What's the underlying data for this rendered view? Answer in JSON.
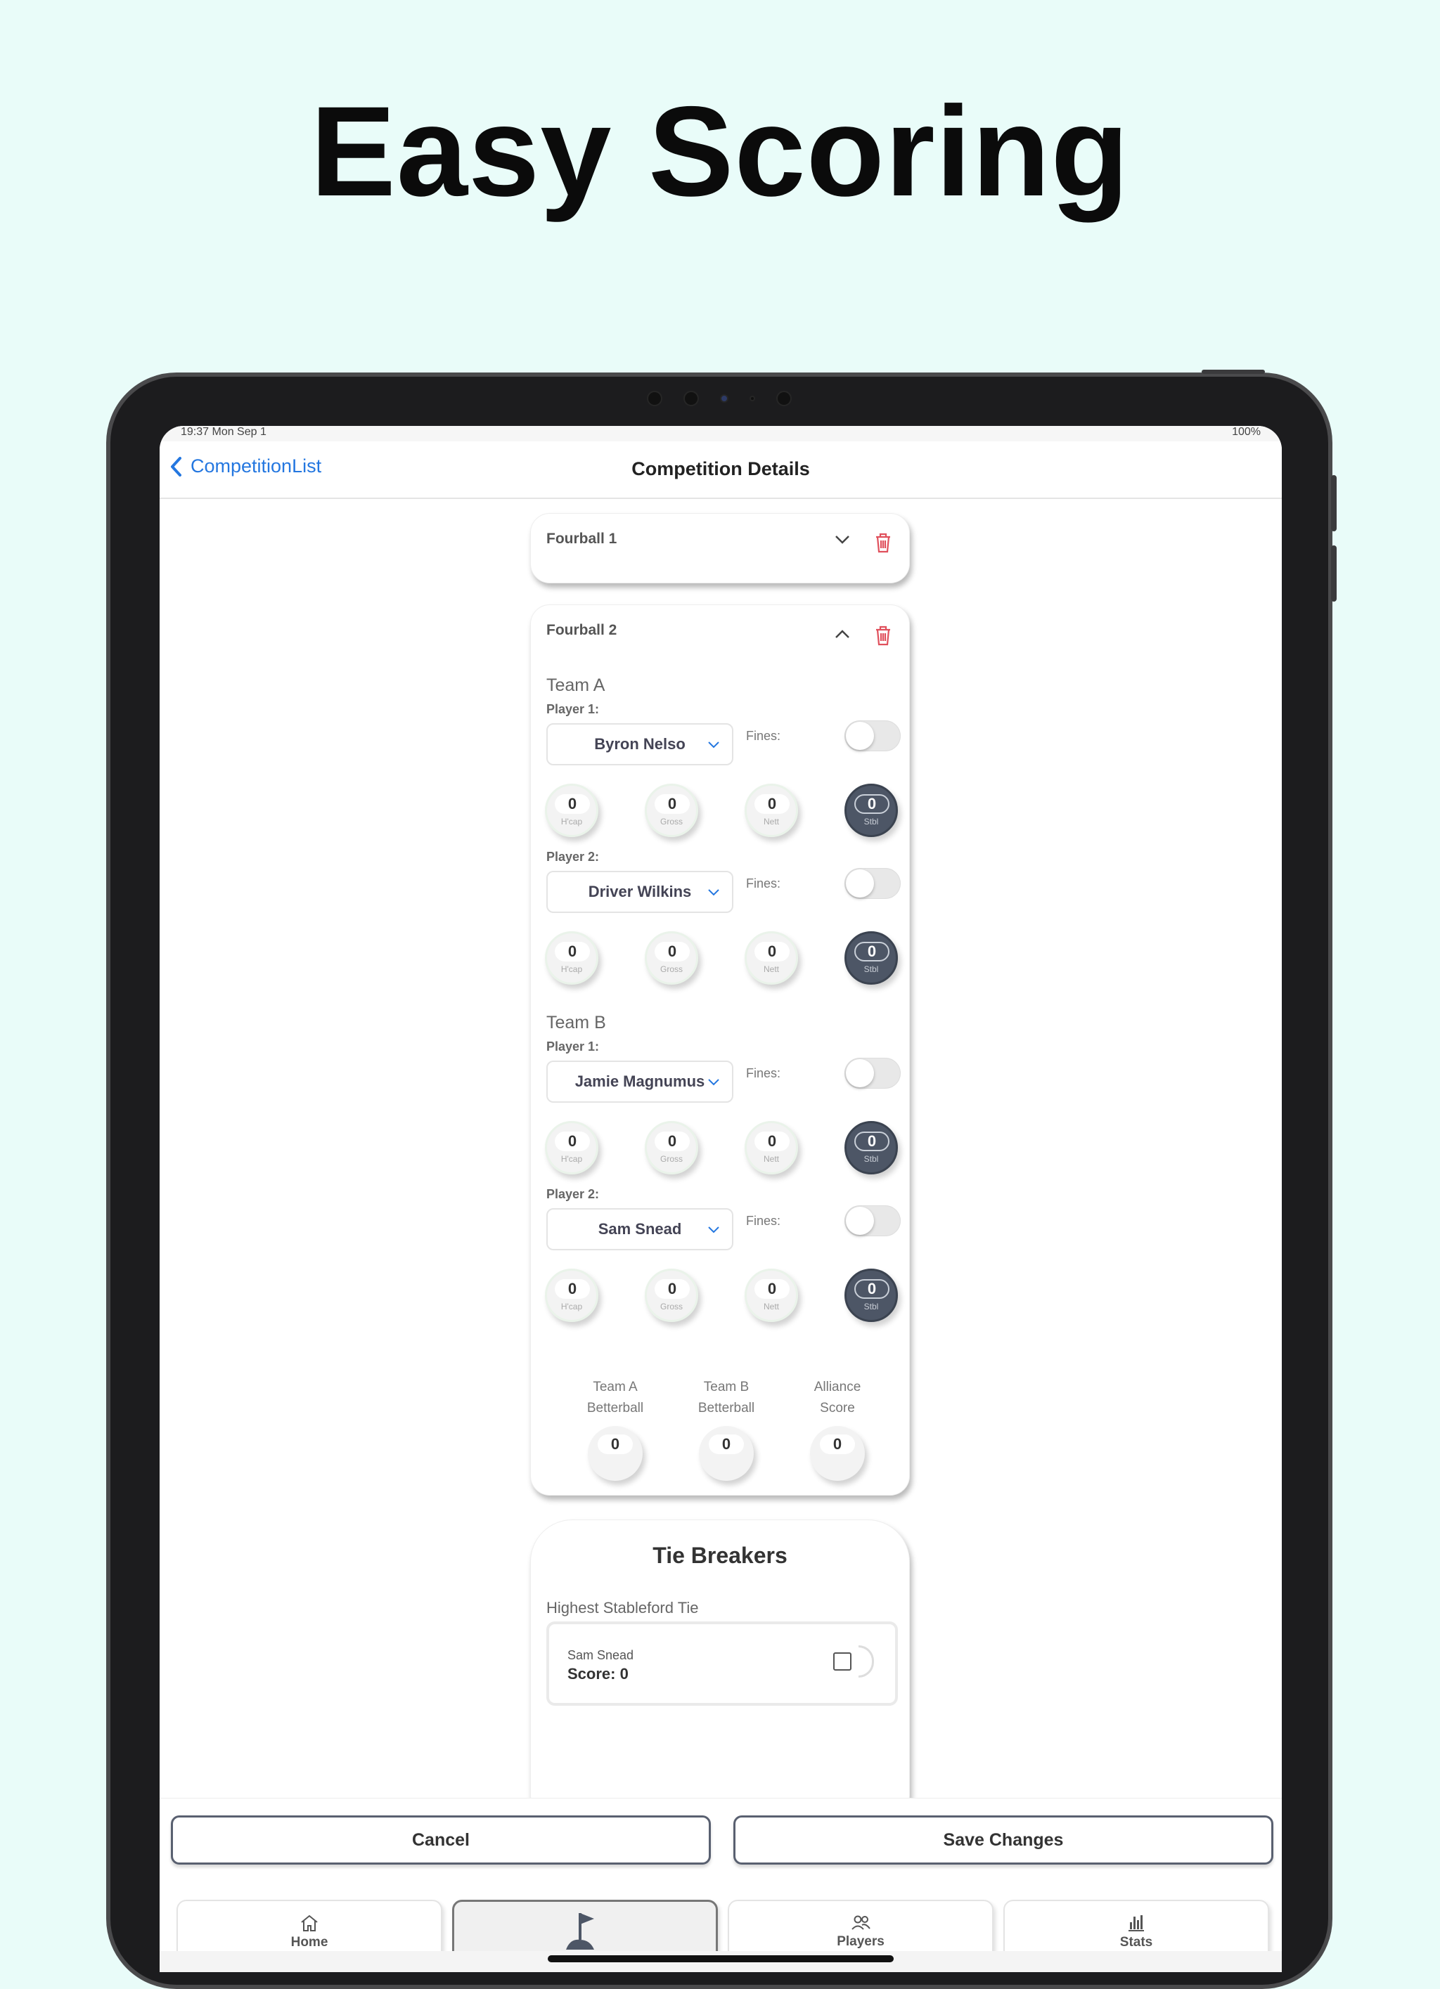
{
  "headline": "Easy Scoring",
  "status_bar": {
    "time": "19:37  Mon Sep 1",
    "battery": "100%"
  },
  "nav": {
    "back_label": "CompetitionList",
    "title": "Competition Details"
  },
  "fourball1": {
    "title": "Fourball 1"
  },
  "fourball2": {
    "title": "Fourball 2",
    "team_a": {
      "label": "Team A",
      "player1": {
        "label": "Player 1:",
        "name": "Byron Nelso",
        "fines_label": "Fines:",
        "fines_on": false,
        "scores": {
          "hcap": "0",
          "gross": "0",
          "nett": "0",
          "stbl": "0"
        }
      },
      "player2": {
        "label": "Player 2:",
        "name": "Driver Wilkins",
        "fines_label": "Fines:",
        "fines_on": false,
        "scores": {
          "hcap": "0",
          "gross": "0",
          "nett": "0",
          "stbl": "0"
        }
      }
    },
    "team_b": {
      "label": "Team B",
      "player1": {
        "label": "Player 1:",
        "name": "Jamie Magnumus",
        "fines_label": "Fines:",
        "fines_on": false,
        "scores": {
          "hcap": "0",
          "gross": "0",
          "nett": "0",
          "stbl": "0"
        }
      },
      "player2": {
        "label": "Player 2:",
        "name": "Sam Snead",
        "fines_label": "Fines:",
        "fines_on": false,
        "scores": {
          "hcap": "0",
          "gross": "0",
          "nett": "0",
          "stbl": "0"
        }
      }
    },
    "score_labels": {
      "hcap": "H'cap",
      "gross": "Gross",
      "nett": "Nett",
      "stbl": "Stbl"
    },
    "summary": {
      "team_a_line1": "Team A",
      "team_a_line2": "Betterball",
      "team_a_value": "0",
      "team_b_line1": "Team B",
      "team_b_line2": "Betterball",
      "team_b_value": "0",
      "alliance_line1": "Alliance",
      "alliance_line2": "Score",
      "alliance_value": "0"
    }
  },
  "tie_breakers": {
    "title": "Tie Breakers",
    "subtitle": "Highest Stableford Tie",
    "entry": {
      "name": "Sam Snead",
      "score": "Score: 0",
      "checked": false
    }
  },
  "actions": {
    "cancel": "Cancel",
    "save": "Save Changes"
  },
  "tabs": [
    {
      "label": "Home",
      "icon": "home-icon"
    },
    {
      "label": "",
      "icon": "golf-flag-icon",
      "active": true
    },
    {
      "label": "Players",
      "icon": "players-icon"
    },
    {
      "label": "Stats",
      "icon": "stats-icon"
    }
  ],
  "colors": {
    "background": "#e9fcf9",
    "accent": "#2477e0",
    "delete": "#e0505c",
    "stbl_circle": "#4d5666"
  }
}
